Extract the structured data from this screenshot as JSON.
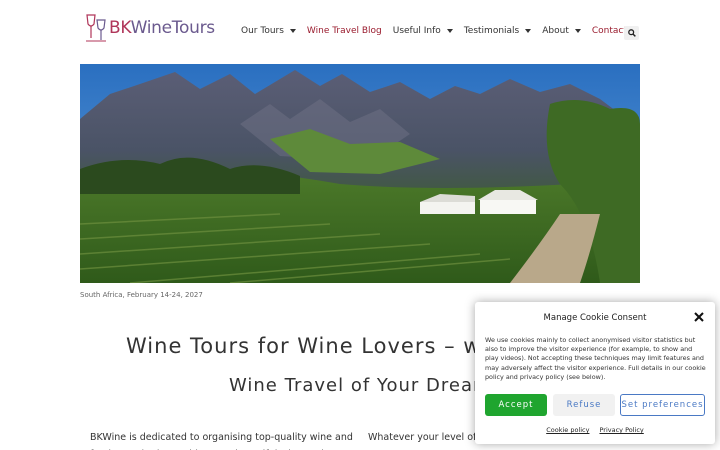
{
  "logo": {
    "text_bk": "BK",
    "text_rest": "WineTours"
  },
  "nav": {
    "items": [
      {
        "label": "Our Tours",
        "dropdown": true,
        "highlight": false
      },
      {
        "label": "Wine Travel Blog",
        "dropdown": false,
        "highlight": true
      },
      {
        "label": "Useful Info",
        "dropdown": true,
        "highlight": false
      },
      {
        "label": "Testimonials",
        "dropdown": true,
        "highlight": false
      },
      {
        "label": "About",
        "dropdown": true,
        "highlight": false
      },
      {
        "label": "Contact",
        "dropdown": false,
        "highlight": true
      }
    ],
    "search_icon": "search-icon"
  },
  "hero": {
    "caption": "South Africa, February 14-24, 2027"
  },
  "main": {
    "heading": "Wine Tours for Wine Lovers – w",
    "subheading": "Wine Travel of Your Dream",
    "col1_text": "BKWine is dedicated to organising top-quality wine and food tours in the world's most beautiful wine regions.",
    "col2_text": "Whatever your level of BKWine Wine Tours welcomes you"
  },
  "cookie": {
    "title": "Manage Cookie Consent",
    "body": "We use cookies mainly to collect anonymised visitor statistics but also to improve the visitor experience (for example, to show and play videos). Not accepting these techniques may limit features and may adversely affect the visitor experience. Full details in our cookie policy and privacy policy (see below).",
    "accept": "Accept",
    "refuse": "Refuse",
    "preferences": "Set preferences",
    "link_cookie": "Cookie policy",
    "link_privacy": "Privacy Policy"
  },
  "colors": {
    "brand": "#9a1c2e",
    "accept": "#1fa52f",
    "link_blue": "#4a79c4"
  }
}
